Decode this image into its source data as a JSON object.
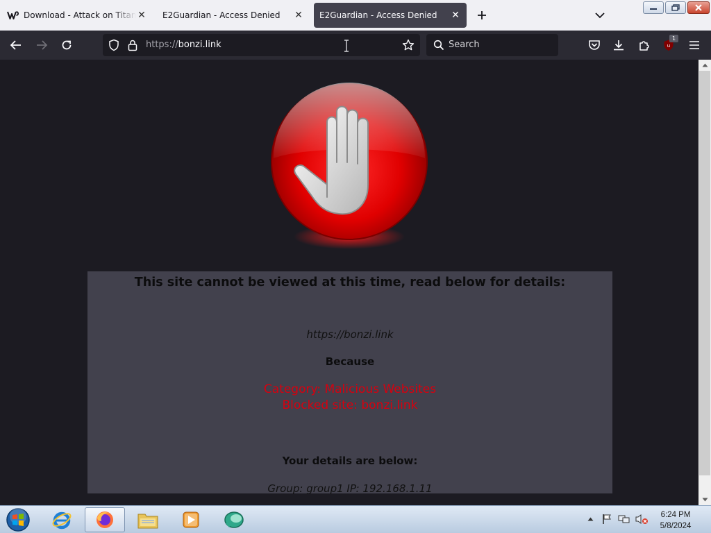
{
  "browser": {
    "tabs": [
      {
        "title": "Download - Attack on Titan Tr",
        "favicon": "w-logo-icon",
        "active": false
      },
      {
        "title": "E2Guardian - Access Denied",
        "favicon": "",
        "active": false
      },
      {
        "title": "E2Guardian - Access Denied",
        "favicon": "",
        "active": true
      }
    ],
    "url": {
      "scheme": "https://",
      "host": "bonzi.link"
    },
    "search_placeholder": "Search",
    "extension_badge": "1"
  },
  "page": {
    "heading": "This site cannot be viewed at this time, read below for details:",
    "blocked_url": "https://bonzi.link",
    "because_label": "Because",
    "category_line": "Category: Malicious Websites",
    "blocked_line": "Blocked site: bonzi.link",
    "details_heading": "Your details are below:",
    "group_line": "Group: group1   IP: 192.168.1.11"
  },
  "taskbar": {
    "items": [
      "internet-explorer-icon",
      "firefox-icon",
      "file-explorer-icon",
      "media-player-icon",
      "bonzi-app-icon"
    ],
    "clock_time": "6:24 PM",
    "clock_date": "5/8/2024"
  },
  "colors": {
    "accent_red": "#d7000f",
    "panel_bg": "#42414d",
    "page_bg": "#1c1b22"
  }
}
